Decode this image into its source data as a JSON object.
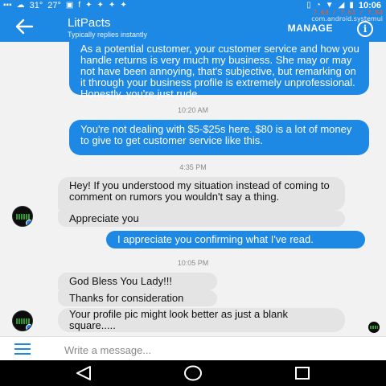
{
  "status_bar": {
    "temp1": "31°",
    "temp2": "27°",
    "time": "10:06",
    "cpu_line1": "7.63 / 7.61 / 7.84",
    "cpu_line2": "com.android.systemui"
  },
  "header": {
    "title": "LitPacts",
    "subtitle": "Typically replies instantly",
    "manage_label": "MANAGE",
    "info_glyph": "i"
  },
  "messages": [
    {
      "type": "sent",
      "text": "As a potential customer, your customer service and how you handle returns is very much my business. She may or may not have been annoying, that's subjective, but remarking on it through your business profile is extremely unprofessional. Honestly, you're just rude."
    },
    {
      "type": "timestamp",
      "text": "10:20 AM"
    },
    {
      "type": "sent",
      "text": "You're not dealing with $5-$25s here. $80 is a lot of money to give to get customer service like this."
    },
    {
      "type": "timestamp",
      "text": "4:35 PM"
    },
    {
      "type": "received",
      "text": "Hey! If you understood my situation instead of coming to comment on rumors you wouldn't say a thing."
    },
    {
      "type": "received",
      "text": "Appreciate you"
    },
    {
      "type": "sent",
      "text": "I appreciate you confirming what I've read."
    },
    {
      "type": "timestamp",
      "text": "10:05 PM"
    },
    {
      "type": "received",
      "text": "God Bless You Lady!!!"
    },
    {
      "type": "received",
      "text": "Thanks for consideration"
    },
    {
      "type": "received",
      "text": "Your profile pic might look better as just a blank square....."
    }
  ],
  "composer": {
    "placeholder": "Write a message..."
  },
  "colors": {
    "accent": "#1e88e5",
    "received_bubble": "#e4e4e4",
    "background": "#f2f2f2"
  },
  "icons": [
    "back-arrow-icon",
    "info-icon",
    "menu-icon",
    "nav-back-icon",
    "nav-home-icon",
    "nav-recents-icon"
  ]
}
